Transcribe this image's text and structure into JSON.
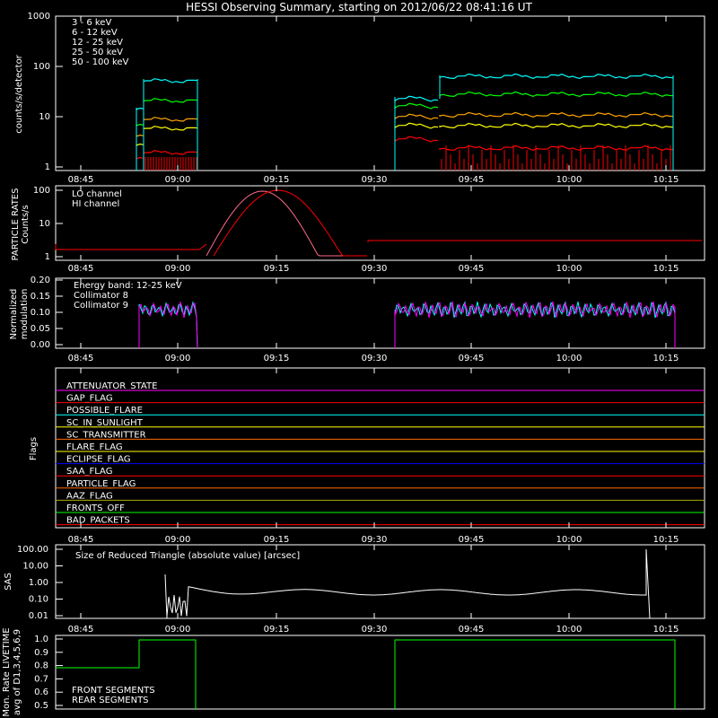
{
  "title": "HESSI Observing Summary, starting on 2012/06/22 08:41:16 UT",
  "time_ticks": [
    "08:45",
    "09:00",
    "09:15",
    "09:30",
    "09:45",
    "10:00",
    "10:15"
  ],
  "colors": {
    "band1": "#ff0000",
    "band2": "#ff6a00",
    "band3": "#ffa500",
    "band4": "#ffff00",
    "band5": "#00ff00",
    "band6": "#00ffff",
    "magenta": "#ff00ff",
    "cyan": "#00ffff",
    "white": "#ffffff",
    "green": "#00ff00",
    "darkgreen": "#008800"
  },
  "chart_data": [
    {
      "id": "count-rates",
      "type": "line",
      "ylabel": "counts/s/detector",
      "yticks": [
        "1000",
        "100",
        "10",
        "1"
      ],
      "legend": [
        {
          "name": "3 - 6  keV",
          "color": "#ff0000"
        },
        {
          "name": "6 - 12  keV",
          "color": "#ff6a00"
        },
        {
          "name": "12 - 25  keV",
          "color": "#ffa500"
        },
        {
          "name": "25 - 50  keV",
          "color": "#00ff00"
        },
        {
          "name": "50 - 100  keV",
          "color": "#00ffff"
        }
      ],
      "series": [
        {
          "name": "50 - 100  keV",
          "color": "#00ffff",
          "values_by_segment": [
            [
              0.0,
              15.0
            ],
            [
              0.0,
              60.0
            ],
            [
              0.0,
              55.0
            ],
            [
              1.0,
              0.0
            ],
            [
              0.0,
              25.0
            ],
            [
              0.0,
              22.0
            ],
            [
              0.0,
              65.0
            ],
            [
              0.0,
              70.0
            ],
            [
              0.0,
              60.0
            ]
          ]
        },
        {
          "name": "25 - 50  keV",
          "color": "#00ff00",
          "values_by_segment": [
            [
              0.0,
              10.0
            ],
            [
              0.0,
              22.0
            ],
            [
              0.0,
              18.0
            ],
            [
              1.0,
              0.0
            ],
            [
              0.0,
              14.0
            ],
            [
              0.0,
              12.0
            ],
            [
              0.0,
              30.0
            ],
            [
              0.0,
              25.0
            ],
            [
              0.0,
              22.0
            ]
          ]
        },
        {
          "name": "12 - 25  keV",
          "color": "#ffa500",
          "values_by_segment": [
            [
              0.0,
              9.0
            ],
            [
              0.0,
              12.0
            ],
            [
              0.0,
              10.0
            ],
            [
              1.0,
              0.0
            ],
            [
              0.0,
              10.0
            ],
            [
              0.0,
              9.0
            ],
            [
              0.0,
              11.0
            ],
            [
              0.0,
              10.0
            ],
            [
              0.0,
              9.0
            ]
          ]
        },
        {
          "name": "6 - 12  keV",
          "color": "#ffff00",
          "values_by_segment": [
            [
              0.0,
              5.0
            ],
            [
              0.0,
              7.0
            ],
            [
              0.0,
              6.0
            ],
            [
              1.0,
              0.0
            ],
            [
              0.0,
              5.0
            ],
            [
              0.0,
              5.0
            ],
            [
              0.0,
              7.0
            ],
            [
              0.0,
              7.0
            ],
            [
              0.0,
              6.0
            ]
          ]
        },
        {
          "name": "3 - 6  keV",
          "color": "#ff0000",
          "values_by_segment": [
            [
              0.0,
              2.0
            ],
            [
              0.0,
              2.5
            ],
            [
              0.0,
              2.0
            ],
            [
              1.0,
              0.0
            ],
            [
              0.0,
              2.5
            ],
            [
              0.0,
              2.5
            ],
            [
              0.0,
              3.0
            ],
            [
              0.0,
              3.0
            ],
            [
              0.0,
              2.5
            ]
          ]
        }
      ]
    },
    {
      "id": "particle-rates",
      "type": "line",
      "ylabel": "PARTICLE RATES Counts/s",
      "yticks": [
        "100",
        "10",
        "1"
      ],
      "legend": [
        {
          "name": "LO channel",
          "color": "#ff0000"
        },
        {
          "name": "HI channel",
          "color": "#ff6a8a"
        }
      ]
    },
    {
      "id": "modulation",
      "type": "line",
      "ylabel": "Normalized modulation",
      "yticks": [
        "0.20",
        "0.15",
        "0.10",
        "0.05",
        "0.00"
      ],
      "legend": [
        {
          "name": "Energy band: 12-25 keV",
          "color": "#ffffff"
        },
        {
          "name": "Collimator 8",
          "color": "#00ffff"
        },
        {
          "name": "Collimator 9",
          "color": "#ff00ff"
        }
      ]
    },
    {
      "id": "flags",
      "type": "line",
      "ylabel": "Flags",
      "flags": [
        {
          "name": "ATTENUATOR_STATE",
          "color": "#ff00ff"
        },
        {
          "name": "GAP_FLAG",
          "color": "#ff0000"
        },
        {
          "name": "POSSIBLE_FLARE",
          "color": "#00ffff"
        },
        {
          "name": "SC_IN_SUNLIGHT",
          "color": "#ffff00"
        },
        {
          "name": "SC_TRANSMITTER",
          "color": "#ff6a00"
        },
        {
          "name": "FLARE_FLAG",
          "color": "#ffff00"
        },
        {
          "name": "ECLIPSE_FLAG",
          "color": "#0000ff"
        },
        {
          "name": "SAA_FLAG",
          "color": "#ff0000"
        },
        {
          "name": "PARTICLE_FLAG",
          "color": "#ff6a00"
        },
        {
          "name": "AAZ_FLAG",
          "color": "#aaaa00"
        },
        {
          "name": "FRONTS_OFF",
          "color": "#00ff00"
        },
        {
          "name": "BAD_PACKETS",
          "color": "#ff0000"
        }
      ]
    },
    {
      "id": "sas",
      "type": "line",
      "ylabel": "SAS",
      "yticks": [
        "100.00",
        "10.00",
        "1.00",
        "0.10",
        "0.01"
      ],
      "legend": [
        {
          "name": "Size of Reduced Triangle (absolute value) [arcsec]",
          "color": "#ff00ff"
        }
      ]
    },
    {
      "id": "livetime",
      "type": "line",
      "ylabel": "Mon. Rate LIVETIME avg of D1,3,4,5,6,9",
      "yticks": [
        "1.0",
        "0.9",
        "0.8",
        "0.7",
        "0.6",
        "0.5"
      ],
      "legend": [
        {
          "name": "FRONT SEGMENTS",
          "color": "#00ff00"
        },
        {
          "name": "REAR SEGMENTS",
          "color": "#008800"
        }
      ]
    }
  ]
}
